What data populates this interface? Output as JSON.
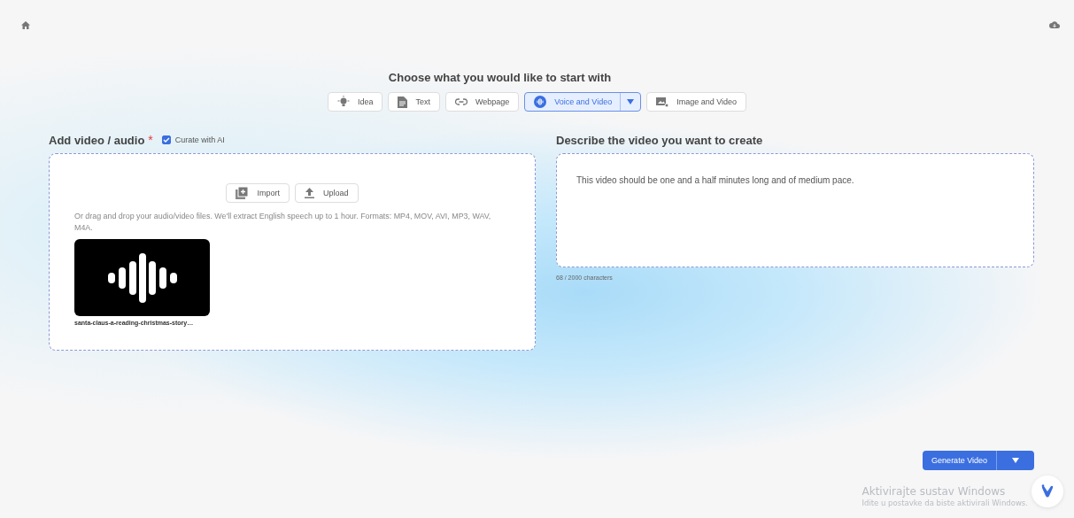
{
  "heading": "Choose what you would like to start with",
  "tabs": [
    {
      "label": "Idea",
      "kind": "bulb",
      "selected": false,
      "has_menu": false
    },
    {
      "label": "Text",
      "kind": "document",
      "selected": false,
      "has_menu": false
    },
    {
      "label": "Webpage",
      "kind": "link",
      "selected": false,
      "has_menu": false
    },
    {
      "label": "Voice and Video",
      "kind": "voice",
      "selected": true,
      "has_menu": true
    },
    {
      "label": "Image and Video",
      "kind": "image",
      "selected": false,
      "has_menu": false
    }
  ],
  "media": {
    "title": "Add video / audio",
    "required_mark": "*",
    "curate": {
      "label": "Curate with AI",
      "checked": true
    },
    "buttons": [
      {
        "label": "Import",
        "kind": "import"
      },
      {
        "label": "Upload",
        "kind": "upload"
      }
    ],
    "hint": "Or drag and drop your audio/video files. We'll extract English speech up to 1 hour. Formats: MP4, MOV, AVI, MP3, WAV, M4A.",
    "files": [
      {
        "name": "santa-claus-a-reading-christmas-story…"
      }
    ]
  },
  "describe": {
    "title": "Describe the video you want to create",
    "value": "This video should be one and a half minutes long and of medium pace.",
    "counter": "68 / 2000 characters"
  },
  "generate_button": "Generate Video",
  "os_notice": {
    "title": "Aktivirajte sustav Windows",
    "text": "Idite u postavke da biste aktivirali Windows."
  }
}
